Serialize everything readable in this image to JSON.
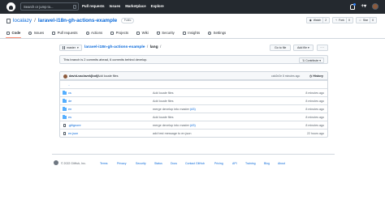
{
  "header": {
    "search_placeholder": "Search or jump to...",
    "search_shortcut": "/",
    "nav": [
      "Pull requests",
      "Issues",
      "Marketplace",
      "Explore"
    ],
    "icons": [
      "github-logo-icon",
      "bell-icon",
      "plus-icon",
      "avatar"
    ]
  },
  "repo": {
    "owner": "localazy",
    "separator": "/",
    "name": "laravel-i18n-gh-actions-example",
    "visibility": "Public",
    "actions": {
      "watch_label": "Watch",
      "watch_count": "2",
      "fork_label": "Fork",
      "fork_count": "0",
      "star_label": "Star",
      "star_count": "0"
    }
  },
  "tabs": [
    {
      "label": "Code",
      "active": true,
      "icon": "code-icon"
    },
    {
      "label": "Issues",
      "active": false,
      "icon": "issue-icon"
    },
    {
      "label": "Pull requests",
      "active": false,
      "icon": "pull-request-icon"
    },
    {
      "label": "Actions",
      "active": false,
      "icon": "play-icon"
    },
    {
      "label": "Projects",
      "active": false,
      "icon": "table-icon"
    },
    {
      "label": "Wiki",
      "active": false,
      "icon": "book-icon"
    },
    {
      "label": "Security",
      "active": false,
      "icon": "shield-icon"
    },
    {
      "label": "Insights",
      "active": false,
      "icon": "graph-icon"
    },
    {
      "label": "Settings",
      "active": false,
      "icon": "gear-icon"
    }
  ],
  "branch": {
    "name": "master",
    "breadcrumb_repo": "laravel-i18n-gh-actions-example",
    "breadcrumb_sep": "/",
    "breadcrumb_dir": "lang",
    "breadcrumb_trail": "/",
    "goto_file_label": "Go to file",
    "add_file_label": "Add file",
    "more_label": "···"
  },
  "ahead": {
    "text": "This branch is 2 commits ahead, 6 commits behind develop.",
    "contribute_label": "Contribute"
  },
  "latest_commit": {
    "author": "david-vaclavek[bot]",
    "message": "Add locale files",
    "sha_and_time": "cab2e2e 8 minutes ago",
    "history_label": "History"
  },
  "files": [
    {
      "name": "..",
      "type": "parent",
      "message": "",
      "pr": "",
      "age": ""
    },
    {
      "name": "cs",
      "type": "folder",
      "message": "Add locale files",
      "pr": "",
      "age": "8 minutes ago"
    },
    {
      "name": "de",
      "type": "folder",
      "message": "Add locale files",
      "pr": "",
      "age": "8 minutes ago"
    },
    {
      "name": "en",
      "type": "folder",
      "message": "merge develop into master ",
      "pr": "(#3)",
      "age": "8 minutes ago"
    },
    {
      "name": "es",
      "type": "folder",
      "message": "Add locale files",
      "pr": "",
      "age": "8 minutes ago"
    },
    {
      "name": ".gitignore",
      "type": "file",
      "message": "merge develop into master ",
      "pr": "(#3)",
      "age": "8 minutes ago"
    },
    {
      "name": "en.json",
      "type": "file",
      "message": "add test message to en.json",
      "pr": "",
      "age": "22 hours ago"
    }
  ],
  "footer": {
    "copyright": "© 2022 GitHub, Inc.",
    "links": [
      "Terms",
      "Privacy",
      "Security",
      "Status",
      "Docs",
      "Contact GitHub",
      "Pricing",
      "API",
      "Training",
      "Blog",
      "About"
    ]
  }
}
